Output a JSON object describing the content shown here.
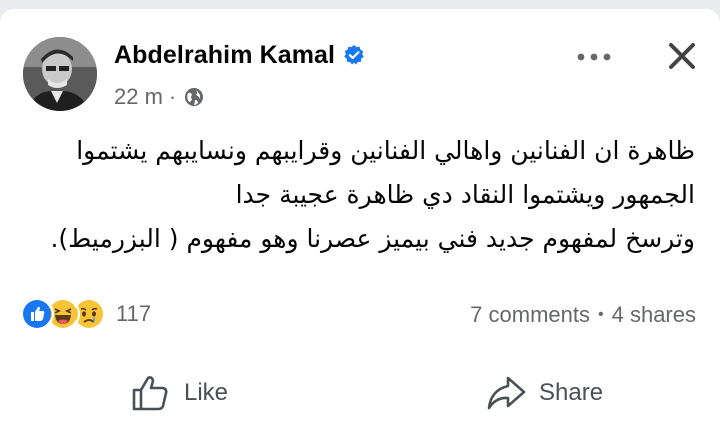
{
  "post": {
    "author": "Abdelrahim Kamal",
    "time": "22 m",
    "meta_dot": "·",
    "text_lines": [
      "ظاهرة ان الفنانين  واهالي الفنانين وقرايبهم ونسايبهم يشتموا",
      "الجمهور ويشتموا النقاد دي ظاهرة  عجيبة جدا",
      "وترسخ لمفهوم جديد فني بيميز عصرنا وهو مفهوم ( البزرميط)."
    ],
    "reaction_count": "117",
    "reaction_icons": [
      "like-reaction-icon",
      "haha-reaction-icon",
      "sad-reaction-icon"
    ],
    "comments": "7 comments",
    "stats_sep": "•",
    "shares": "4 shares"
  },
  "actions": {
    "like_label": "Like",
    "share_label": "Share"
  },
  "colors": {
    "verified": "#1877f2",
    "like_blue": "#1877f2",
    "emoji_yellow": "#f7c438",
    "muted_text": "#65676b",
    "background": "#e9ebee"
  }
}
